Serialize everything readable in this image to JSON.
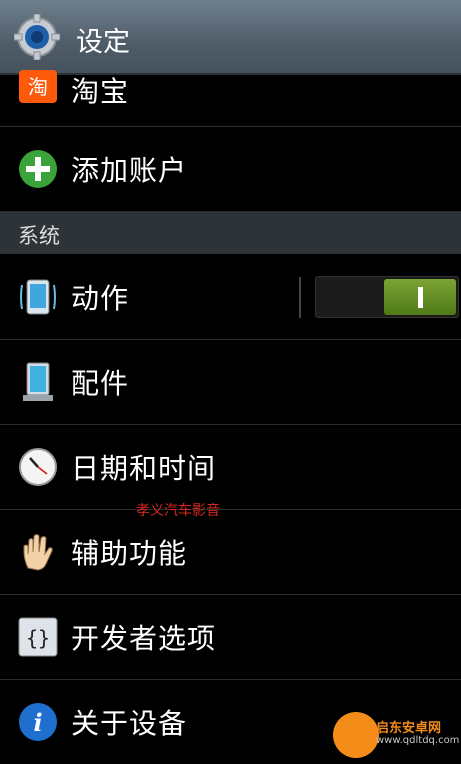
{
  "header": {
    "title": "设定",
    "icon": "gear-icon"
  },
  "accounts": [
    {
      "label": "淘宝",
      "icon": "taobao-icon"
    },
    {
      "label": "添加账户",
      "icon": "add-circle-icon"
    }
  ],
  "section_title": "系统",
  "system_items": [
    {
      "label": "动作",
      "icon": "motion-phone-icon",
      "toggle_on": true
    },
    {
      "label": "配件",
      "icon": "dock-icon"
    },
    {
      "label": "日期和时间",
      "icon": "clock-icon"
    },
    {
      "label": "辅助功能",
      "icon": "hand-icon"
    },
    {
      "label": "开发者选项",
      "icon": "braces-icon"
    },
    {
      "label": "关于设备",
      "icon": "info-icon"
    }
  ],
  "watermark_center": "孝义汽车影音",
  "watermark_corner": {
    "name": "启东安卓网",
    "url": "www.qdltdq.com"
  },
  "colors": {
    "header": "#566470",
    "toggle_on": "#6a9527",
    "section": "#2e3338"
  }
}
